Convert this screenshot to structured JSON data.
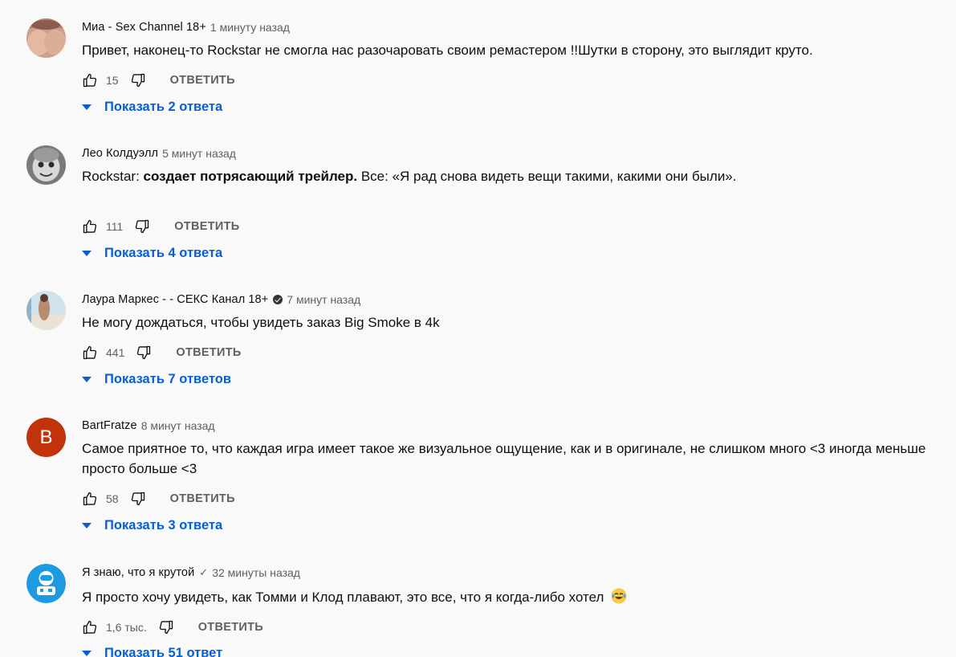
{
  "comments": [
    {
      "author": "Миа - Sex Channel 18+",
      "time": "1 минуту назад",
      "text": "Привет, наконец-то Rockstar не смогла нас разочаровать своим ремастером !!Шутки в сторону, это выглядит круто.",
      "likes": "15",
      "reply_label": "ОТВЕТИТЬ",
      "replies_label": "Показать 2 ответа"
    },
    {
      "author": "Лео Колдуэлл",
      "time": "5 минут назад",
      "text_parts": {
        "before": "Rockstar: ",
        "bold": "создает потрясающий трейлер.",
        "after": " Все: «Я рад снова видеть вещи такими, какими они были»."
      },
      "likes": "111",
      "reply_label": "ОТВЕТИТЬ",
      "replies_label": "Показать 4 ответа"
    },
    {
      "author": "Лаура Маркес - - СЕКС Канал 18+",
      "time": "7 минут назад",
      "text": "Не могу дождаться, чтобы увидеть заказ Big Smoke в 4k",
      "likes": "441",
      "reply_label": "ОТВЕТИТЬ",
      "replies_label": "Показать 7 ответов"
    },
    {
      "author": "BartFratze",
      "avatar_letter": "B",
      "time": "8 минут назад",
      "text": "Самое приятное то, что каждая игра имеет такое же визуальное ощущение, как и в оригинале, не слишком много <3 иногда меньше просто больше <3",
      "likes": "58",
      "reply_label": "ОТВЕТИТЬ",
      "replies_label": "Показать 3 ответа"
    },
    {
      "author": "Я знаю, что я крутой",
      "time": "32 минуты назад",
      "text": "Я просто хочу увидеть, как Томми и Клод плавают, это все, что я когда-либо хотел",
      "likes": "1,6 тыс.",
      "reply_label": "ОТВЕТИТЬ",
      "replies_label": "Показать 51 ответ"
    }
  ],
  "colors": {
    "link_blue": "#065fd4",
    "muted_text": "#606060",
    "avatar_b": "#c1330a"
  },
  "icons": [
    "thumbs-up-icon",
    "thumbs-down-icon",
    "caret-down-icon",
    "verified-icon",
    "tears-of-joy-emoji"
  ]
}
